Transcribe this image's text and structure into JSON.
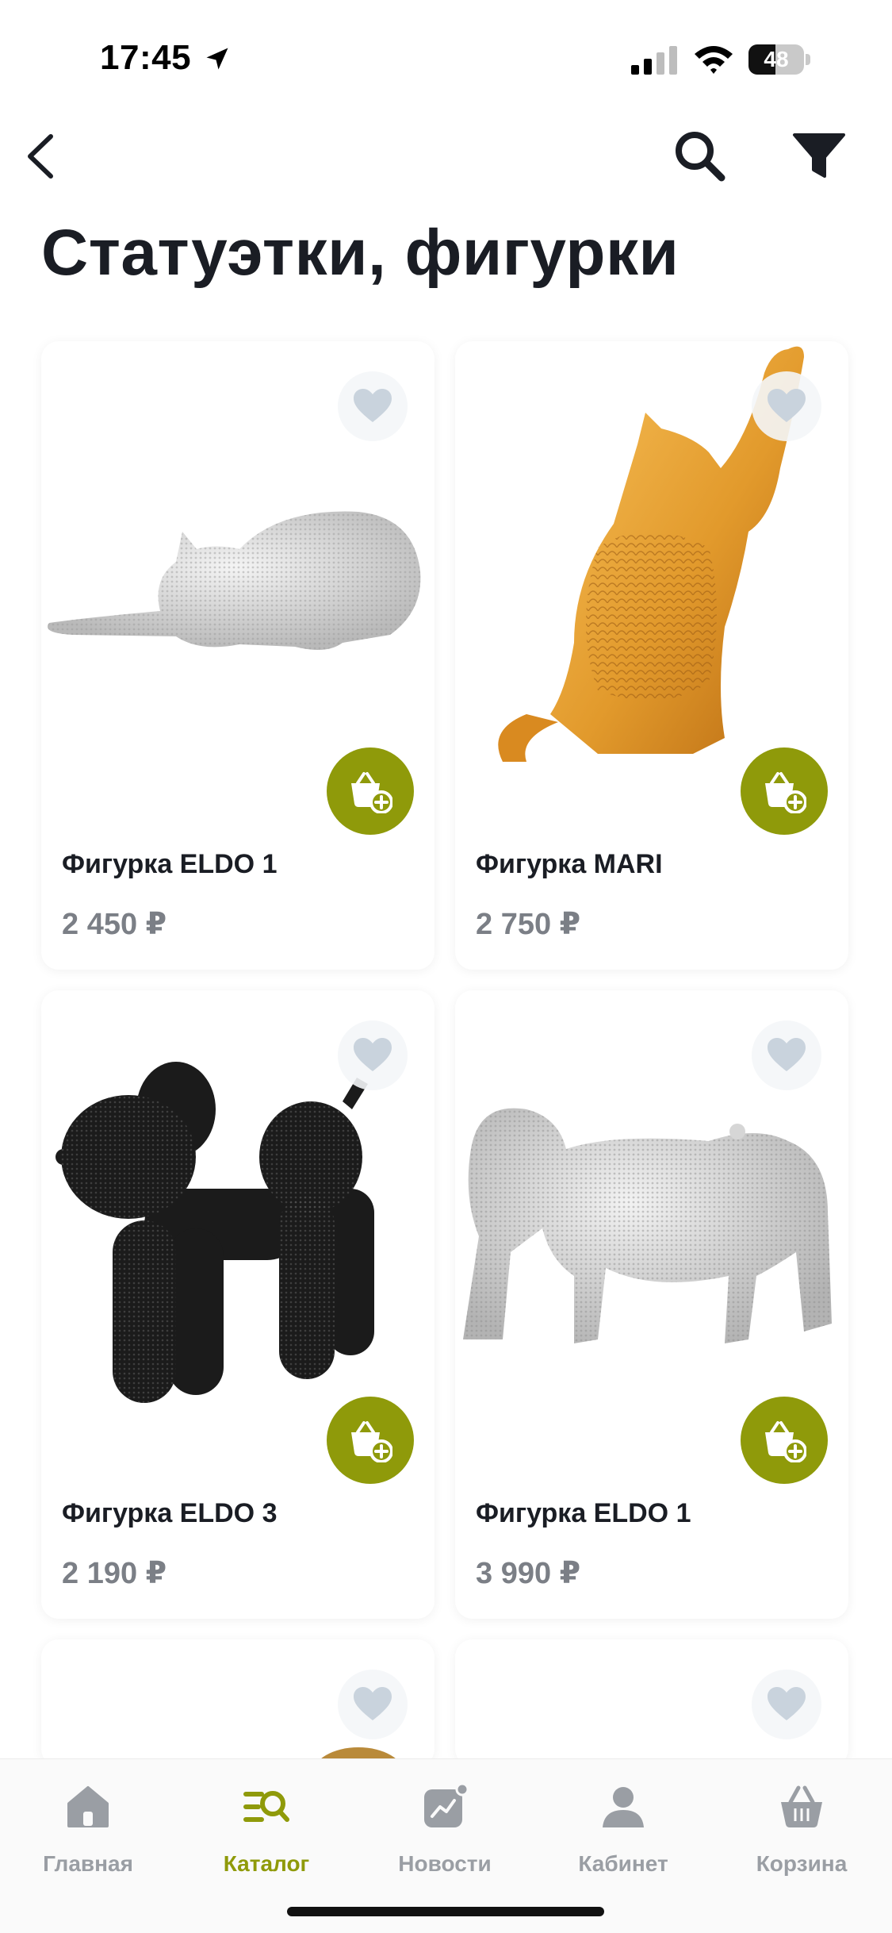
{
  "status_bar": {
    "time": "17:45",
    "battery": "48",
    "battery_level": 0.48
  },
  "header": {
    "title": "Статуэтки, фигурки"
  },
  "products": [
    {
      "name": "Фигурка ELDO 1",
      "price": "2 450 ₽"
    },
    {
      "name": "Фигурка MARI",
      "price": "2 750 ₽"
    },
    {
      "name": "Фигурка ELDO 3",
      "price": "2 190 ₽"
    },
    {
      "name": "Фигурка ELDO 1",
      "price": "3 990 ₽"
    }
  ],
  "tabbar": {
    "items": [
      {
        "label": "Главная",
        "icon": "home-icon"
      },
      {
        "label": "Каталог",
        "icon": "catalog-search-icon",
        "active": true
      },
      {
        "label": "Новости",
        "icon": "news-chart-icon"
      },
      {
        "label": "Кабинет",
        "icon": "profile-icon"
      },
      {
        "label": "Корзина",
        "icon": "basket-icon"
      }
    ]
  },
  "colors": {
    "accent": "#8f9a0a",
    "title": "#1a1d24",
    "price": "#7b7f86",
    "inactive_tab": "#9a9ea4"
  }
}
